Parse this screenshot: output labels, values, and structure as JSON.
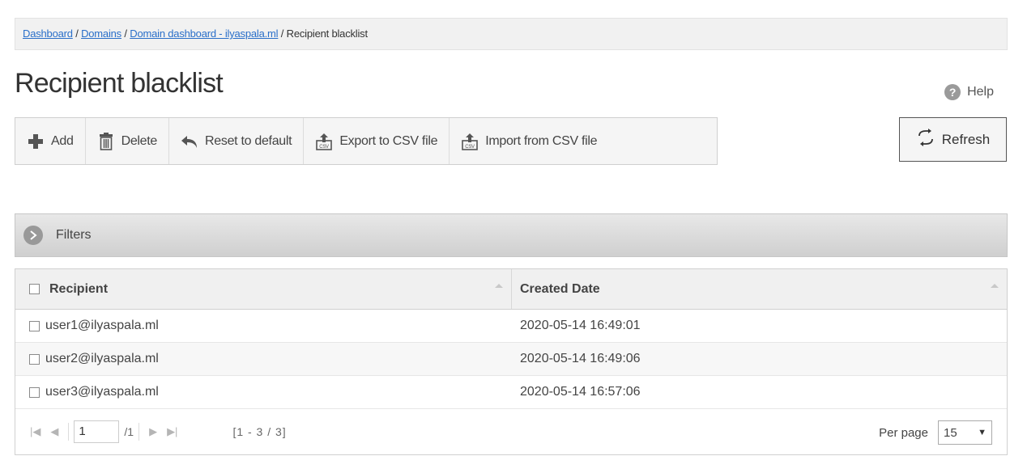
{
  "breadcrumb": {
    "items": [
      "Dashboard",
      "Domains",
      "Domain dashboard - ilyaspala.ml"
    ],
    "current": "Recipient blacklist",
    "separator": "/"
  },
  "page": {
    "title": "Recipient blacklist",
    "help_label": "Help"
  },
  "toolbar": {
    "add": "Add",
    "delete": "Delete",
    "reset": "Reset to default",
    "export": "Export to CSV file",
    "import": "Import from CSV file",
    "refresh": "Refresh"
  },
  "filters": {
    "label": "Filters"
  },
  "table": {
    "columns": [
      "Recipient",
      "Created Date"
    ],
    "rows": [
      {
        "recipient": "user1@ilyaspala.ml",
        "created": "2020-05-14 16:49:01"
      },
      {
        "recipient": "user2@ilyaspala.ml",
        "created": "2020-05-14 16:49:06"
      },
      {
        "recipient": "user3@ilyaspala.ml",
        "created": "2020-05-14 16:57:06"
      }
    ]
  },
  "pager": {
    "page": "1",
    "total": "/1",
    "range": "[1 - 3 / 3]",
    "per_page_label": "Per page",
    "per_page_value": "15"
  },
  "colors": {
    "link": "#2a6fc9",
    "filters_bar": "#d6d6d6",
    "header_bg": "#f0f0f0"
  }
}
